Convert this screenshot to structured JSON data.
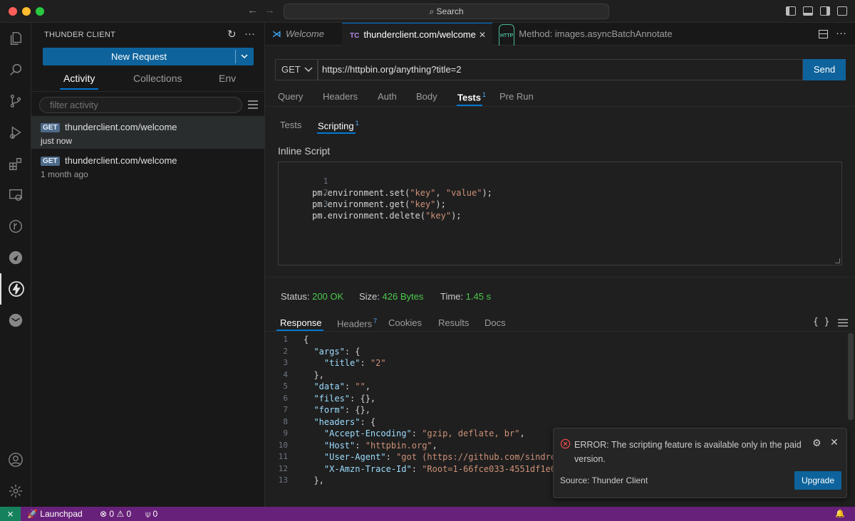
{
  "titlebar": {
    "search_label": "Search",
    "traffic_colors": [
      "#ff5f57",
      "#febc2e",
      "#28c840"
    ]
  },
  "activitybar": {
    "icons": [
      "explorer-icon",
      "search-icon",
      "source-control-icon",
      "run-debug-icon",
      "extensions-icon",
      "remote-explorer-icon",
      "git-graph-icon",
      "pipeline-icon",
      "thunder-client-icon",
      "mail-icon",
      "account-icon",
      "settings-gear-icon"
    ],
    "active": "thunder-client-icon"
  },
  "sidebar": {
    "title": "THUNDER CLIENT",
    "new_request_label": "New Request",
    "tabs": [
      {
        "label": "Activity",
        "active": true
      },
      {
        "label": "Collections",
        "active": false
      },
      {
        "label": "Env",
        "active": false
      }
    ],
    "filter_placeholder": "filter activity",
    "activity": [
      {
        "method": "GET",
        "url": "thunderclient.com/welcome",
        "time": "just now",
        "selected": true
      },
      {
        "method": "GET",
        "url": "thunderclient.com/welcome",
        "time": "1 month ago",
        "selected": false
      }
    ]
  },
  "tabs": [
    {
      "icon": "vscode-icon",
      "label": "Welcome",
      "italic": true,
      "active": false
    },
    {
      "icon_text": "TC",
      "label": "thunderclient.com/welcome",
      "active": true,
      "close": "✕"
    },
    {
      "icon_text": "HTTP",
      "label": "Method: images.asyncBatchAnnotate",
      "italic": false,
      "active": false
    }
  ],
  "request": {
    "method": "GET",
    "url": "https://httpbin.org/anything?title=2",
    "send_label": "Send",
    "tabs": [
      {
        "label": "Query"
      },
      {
        "label": "Headers"
      },
      {
        "label": "Auth"
      },
      {
        "label": "Body"
      },
      {
        "label": "Tests",
        "badge": "1",
        "active": true
      },
      {
        "label": "Pre Run"
      }
    ],
    "sub_tabs": [
      {
        "label": "Tests"
      },
      {
        "label": "Scripting",
        "badge": "1",
        "active": true
      }
    ],
    "inline_script_title": "Inline Script",
    "script_lines": [
      {
        "n": "1",
        "pre": "pm.environment.set(",
        "s1": "\"key\"",
        "mid": ", ",
        "s2": "\"value\"",
        "post": ");"
      },
      {
        "n": "2",
        "pre": "pm.environment.get(",
        "s1": "\"key\"",
        "mid": "",
        "s2": "",
        "post": ");"
      },
      {
        "n": "3",
        "pre": "pm.environment.delete(",
        "s1": "\"key\"",
        "mid": "",
        "s2": "",
        "post": ");"
      }
    ]
  },
  "response": {
    "status_label": "Status:",
    "status_value": "200 OK",
    "size_label": "Size:",
    "size_value": "426 Bytes",
    "time_label": "Time:",
    "time_value": "1.45 s",
    "tabs": [
      {
        "label": "Response",
        "active": true
      },
      {
        "label": "Headers",
        "badge": "7"
      },
      {
        "label": "Cookies"
      },
      {
        "label": "Results"
      },
      {
        "label": "Docs"
      }
    ],
    "braces_label": "{ }",
    "lines": [
      {
        "n": "1",
        "indent": "",
        "key": "",
        "rest": "{"
      },
      {
        "n": "2",
        "indent": "  ",
        "key": "\"args\"",
        "rest": ": {"
      },
      {
        "n": "3",
        "indent": "    ",
        "key": "\"title\"",
        "rest": ": ",
        "val": "\"2\""
      },
      {
        "n": "4",
        "indent": "  ",
        "key": "",
        "rest": "},"
      },
      {
        "n": "5",
        "indent": "  ",
        "key": "\"data\"",
        "rest": ": ",
        "val": "\"\"",
        "tail": ","
      },
      {
        "n": "6",
        "indent": "  ",
        "key": "\"files\"",
        "rest": ": {},"
      },
      {
        "n": "7",
        "indent": "  ",
        "key": "\"form\"",
        "rest": ": {},"
      },
      {
        "n": "8",
        "indent": "  ",
        "key": "\"headers\"",
        "rest": ": {"
      },
      {
        "n": "9",
        "indent": "    ",
        "key": "\"Accept-Encoding\"",
        "rest": ": ",
        "val": "\"gzip, deflate, br\"",
        "tail": ","
      },
      {
        "n": "10",
        "indent": "    ",
        "key": "\"Host\"",
        "rest": ": ",
        "val": "\"httpbin.org\"",
        "tail": ","
      },
      {
        "n": "11",
        "indent": "    ",
        "key": "\"User-Agent\"",
        "rest": ": ",
        "val": "\"got (https://github.com/sindresorh"
      },
      {
        "n": "12",
        "indent": "    ",
        "key": "\"X-Amzn-Trace-Id\"",
        "rest": ": ",
        "val": "\"Root=1-66fce033-4551df1e6f0e6"
      },
      {
        "n": "13",
        "indent": "  ",
        "key": "",
        "rest": "},"
      }
    ]
  },
  "notification": {
    "message": "ERROR: The scripting feature is available only in the paid version.",
    "source": "Source: Thunder Client",
    "upgrade_label": "Upgrade"
  },
  "statusbar": {
    "remote_glyph": "⨯",
    "launchpad_label": "Launchpad",
    "errors": "0",
    "warnings": "0",
    "ports": "0",
    "bell_glyph": "🔔"
  },
  "colors": {
    "accent": "#0078d4",
    "button": "#0e639c",
    "status_ok": "#4cc94c",
    "statusbar": "#68217a",
    "remote": "#16825d",
    "error": "#f14c4c"
  }
}
